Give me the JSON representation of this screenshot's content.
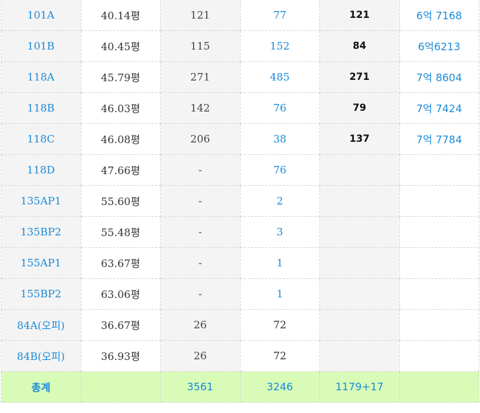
{
  "rows": [
    {
      "type": "101A",
      "area": "40.14평",
      "c3": "121",
      "c4": "77",
      "c4_link": true,
      "c5": "121",
      "c6": "6억 7168"
    },
    {
      "type": "101B",
      "area": "40.45평",
      "c3": "115",
      "c4": "152",
      "c4_link": true,
      "c5": "84",
      "c6": "6억6213"
    },
    {
      "type": "118A",
      "area": "45.79평",
      "c3": "271",
      "c4": "485",
      "c4_link": true,
      "c5": "271",
      "c6": "7억 8604"
    },
    {
      "type": "118B",
      "area": "46.03평",
      "c3": "142",
      "c4": "76",
      "c4_link": true,
      "c5": "79",
      "c6": "7억 7424"
    },
    {
      "type": "118C",
      "area": "46.08평",
      "c3": "206",
      "c4": "38",
      "c4_link": true,
      "c5": "137",
      "c6": "7억 7784"
    },
    {
      "type": "118D",
      "area": "47.66평",
      "c3": "-",
      "c4": "76",
      "c4_link": true,
      "c5": "",
      "c6": ""
    },
    {
      "type": "135AP1",
      "area": "55.60평",
      "c3": "-",
      "c4": "2",
      "c4_link": true,
      "c5": "",
      "c6": ""
    },
    {
      "type": "135BP2",
      "area": "55.48평",
      "c3": "-",
      "c4": "3",
      "c4_link": true,
      "c5": "",
      "c6": ""
    },
    {
      "type": "155AP1",
      "area": "63.67평",
      "c3": "-",
      "c4": "1",
      "c4_link": true,
      "c5": "",
      "c6": ""
    },
    {
      "type": "155BP2",
      "area": "63.06평",
      "c3": "-",
      "c4": "1",
      "c4_link": true,
      "c5": "",
      "c6": ""
    },
    {
      "type": "84A(오피)",
      "area": "36.67평",
      "c3": "26",
      "c4": "72",
      "c4_link": false,
      "c5": "",
      "c6": ""
    },
    {
      "type": "84B(오피)",
      "area": "36.93평",
      "c3": "26",
      "c4": "72",
      "c4_link": false,
      "c5": "",
      "c6": ""
    }
  ],
  "total": {
    "label": "총계",
    "c3": "3561",
    "c4": "3246",
    "c5": "1179+17",
    "c6": ""
  }
}
